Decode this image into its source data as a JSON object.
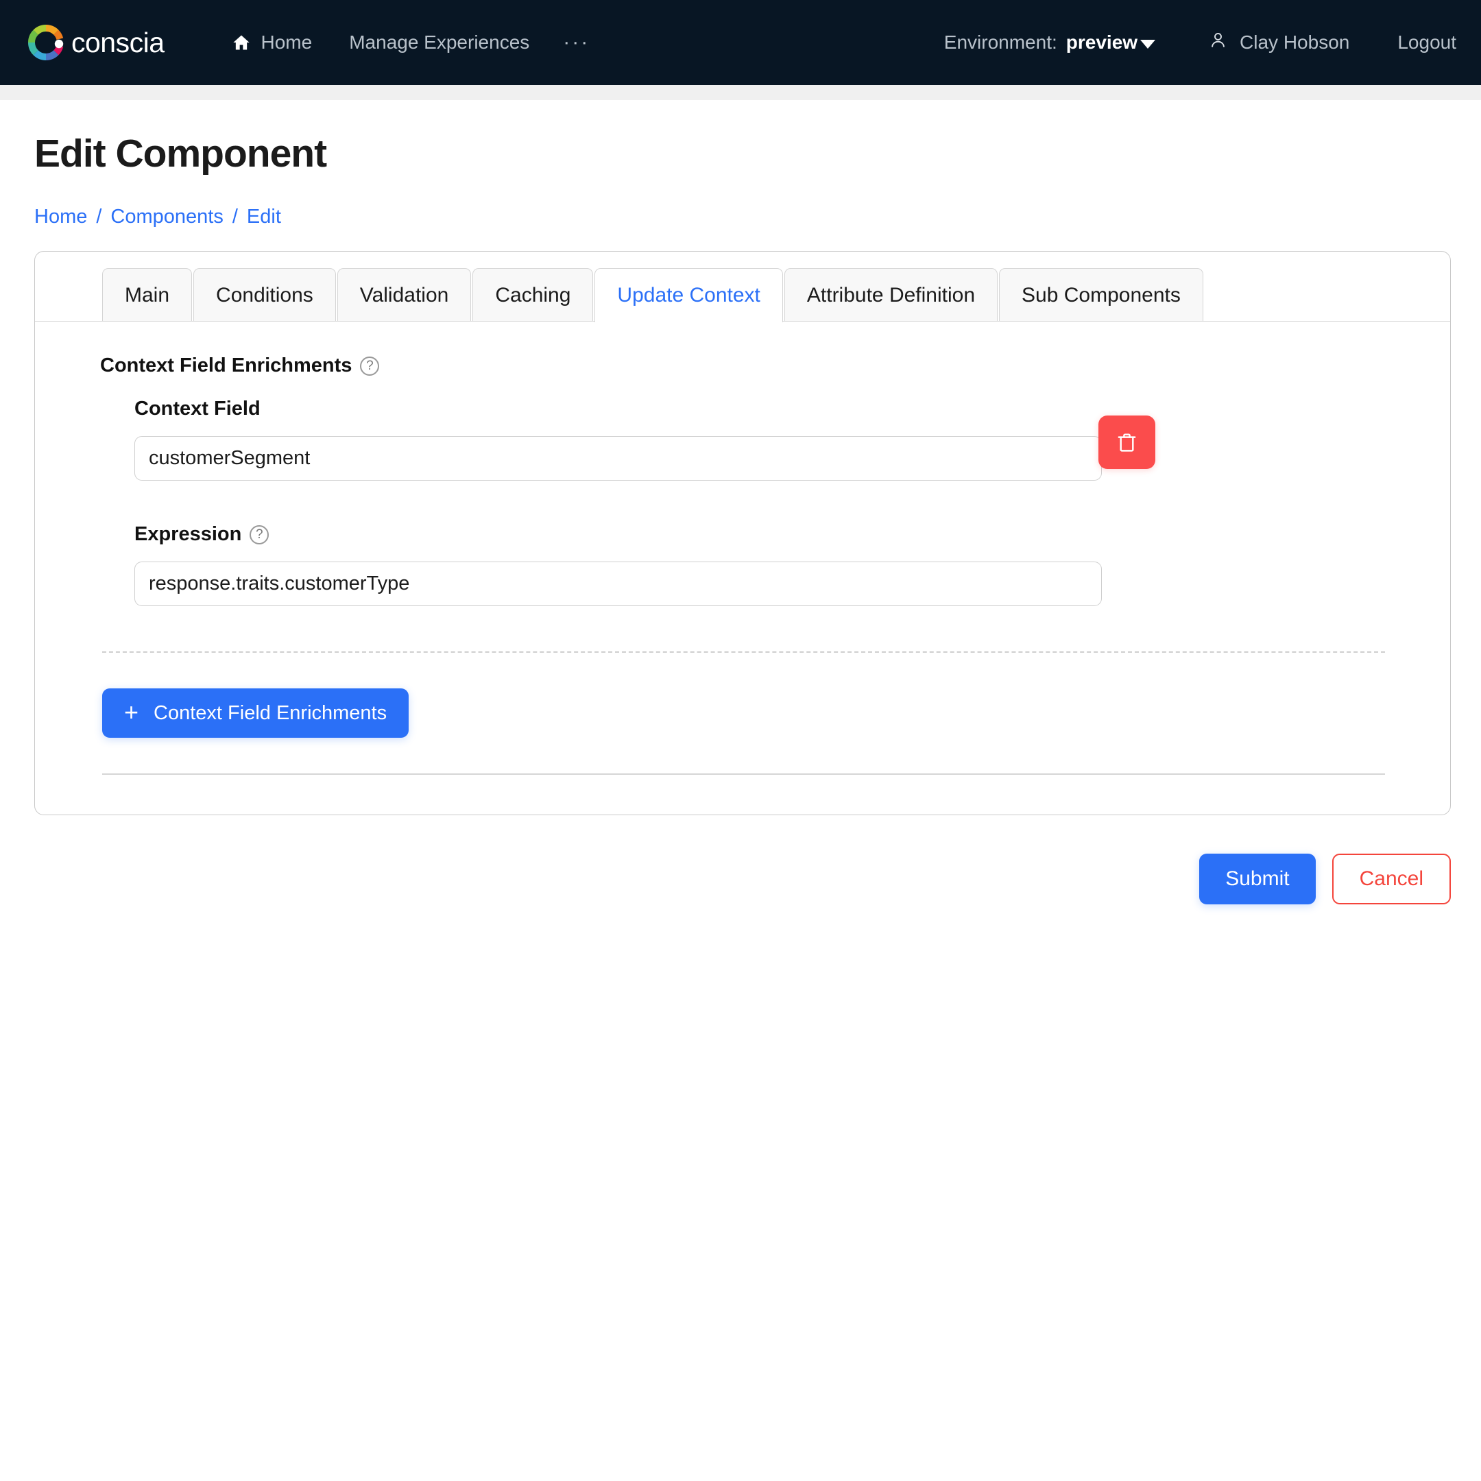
{
  "navbar": {
    "brand_name": "conscia",
    "brand_icon": "conscia-color-wheel-logo",
    "links": [
      {
        "label": "Home",
        "icon": "home-icon"
      },
      {
        "label": "Manage Experiences",
        "icon": ""
      }
    ],
    "more_label": "···",
    "environment_label": "Environment:",
    "environment_value": "preview",
    "user_name": "Clay Hobson",
    "user_icon": "person-icon",
    "logout_label": "Logout",
    "background_color": "#081624",
    "text_color": "#b9c2cb"
  },
  "page": {
    "title": "Edit Component",
    "breadcrumb": [
      "Home",
      "Components",
      "Edit"
    ],
    "breadcrumb_separator": "/",
    "link_color": "#2b70f7"
  },
  "tabs": [
    {
      "label": "Main",
      "active": false
    },
    {
      "label": "Conditions",
      "active": false
    },
    {
      "label": "Validation",
      "active": false
    },
    {
      "label": "Caching",
      "active": false
    },
    {
      "label": "Update Context",
      "active": true
    },
    {
      "label": "Attribute Definition",
      "active": false
    },
    {
      "label": "Sub Components",
      "active": false
    }
  ],
  "panel": {
    "section_title": "Context Field Enrichments",
    "section_help_icon": "question-circle-icon",
    "delete_icon": "trash-icon",
    "delete_color": "#fb4c4c",
    "enrichment": {
      "context_field_label": "Context Field",
      "context_field_value": "customerSegment",
      "context_field_placeholder": "",
      "expression_label": "Expression",
      "expression_help_icon": "question-circle-icon",
      "expression_value": "response.traits.customerType",
      "expression_placeholder": ""
    },
    "add_button_label": "Context Field Enrichments",
    "add_button_icon": "plus-icon",
    "add_button_color": "#2b70f7"
  },
  "actions": {
    "submit_label": "Submit",
    "cancel_label": "Cancel",
    "submit_color": "#2b70f7",
    "cancel_color": "#f4453c"
  }
}
